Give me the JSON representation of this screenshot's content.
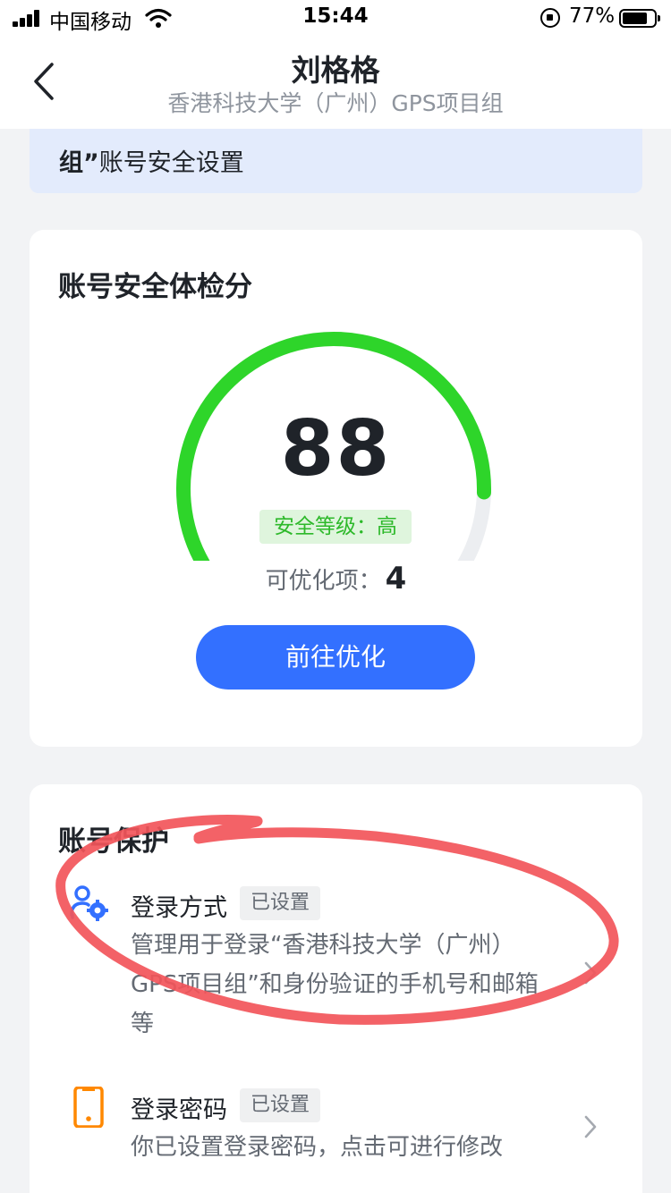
{
  "status_bar": {
    "carrier": "中国移动",
    "time": "15:44",
    "battery": "77%"
  },
  "nav": {
    "title": "刘格格",
    "subtitle": "香港科技大学（广州）GPS项目组"
  },
  "notice": {
    "line2_quote": "组”",
    "line2_rest": "账号安全设置"
  },
  "score_card": {
    "title": "账号安全体检分",
    "score": "88",
    "level": "安全等级：高",
    "optimizable_label": "可优化项：",
    "optimizable_count": "4",
    "button_label": "前往优化",
    "score_fraction": 0.88,
    "gauge_color": "#2ed52a",
    "gauge_track_color": "#eceef1"
  },
  "protection": {
    "title": "账号保护",
    "items": [
      {
        "title": "登录方式",
        "badge": "已设置",
        "desc": "管理用于登录“香港科技大学（广州）GPS项目组”和身份验证的手机号和邮箱等",
        "icon": "user-gear-icon"
      },
      {
        "title": "登录密码",
        "badge": "已设置",
        "desc": "你已设置登录密码，点击可进行修改",
        "icon": "phone-icon"
      }
    ]
  },
  "colors": {
    "accent": "#3370ff",
    "annotation": "#f2555a",
    "icon_orange": "#ff8800",
    "banner": "#e3ebfc"
  }
}
